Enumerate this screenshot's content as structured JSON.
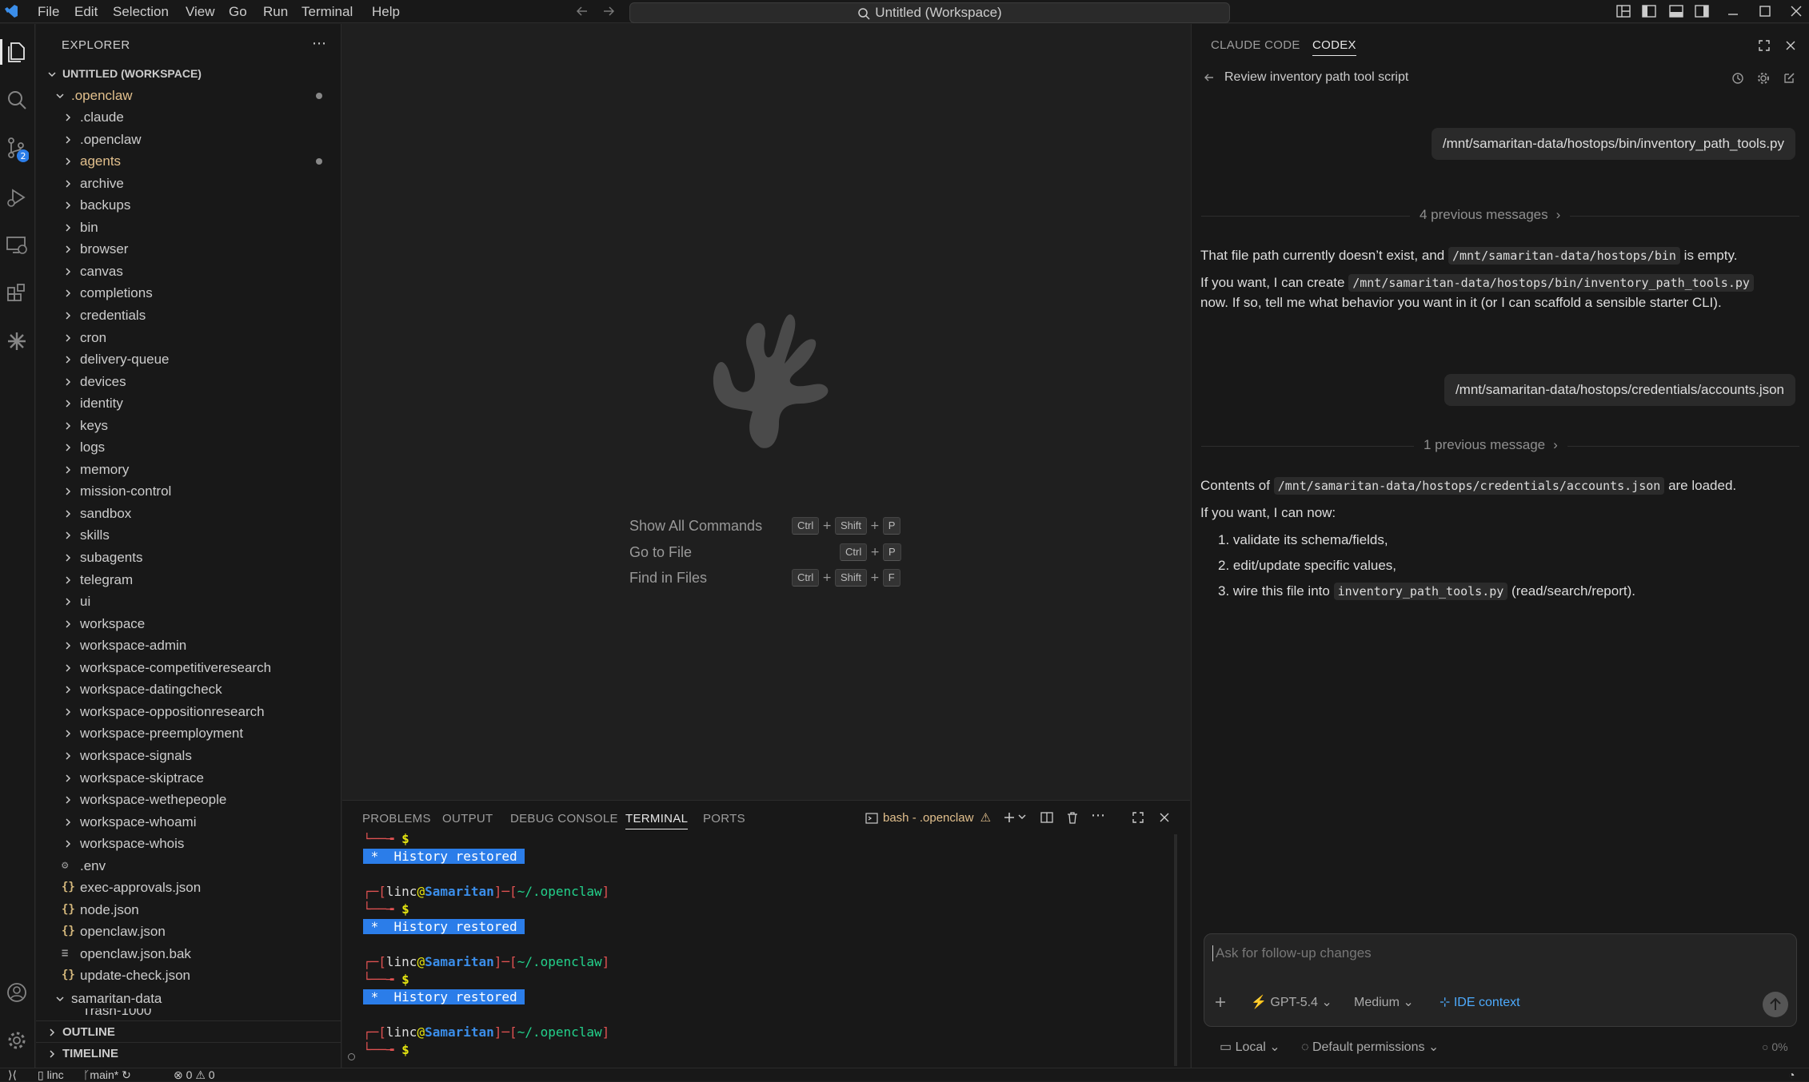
{
  "titlebar": {
    "menus": [
      "File",
      "Edit",
      "Selection",
      "View",
      "Go",
      "Run",
      "Terminal",
      "Help"
    ],
    "command_center": "Untitled (Workspace)"
  },
  "explorer": {
    "title": "EXPLORER",
    "workspace": "UNTITLED (WORKSPACE)",
    "root_folder": ".openclaw",
    "folders": [
      ".claude",
      ".openclaw",
      "agents",
      "archive",
      "backups",
      "bin",
      "browser",
      "canvas",
      "completions",
      "credentials",
      "cron",
      "delivery-queue",
      "devices",
      "identity",
      "keys",
      "logs",
      "memory",
      "mission-control",
      "sandbox",
      "skills",
      "subagents",
      "telegram",
      "ui",
      "workspace",
      "workspace-admin",
      "workspace-competitiveresearch",
      "workspace-datingcheck",
      "workspace-oppositionresearch",
      "workspace-preemployment",
      "workspace-signals",
      "workspace-skiptrace",
      "workspace-wethepeople",
      "workspace-whoami",
      "workspace-whois"
    ],
    "files": [
      ".env",
      "exec-approvals.json",
      "node.json",
      "openclaw.json",
      "openclaw.json.bak",
      "update-check.json"
    ],
    "second_folder": "samaritan-data",
    "partial_item": "Trash-1000",
    "outline": "OUTLINE",
    "timeline": "TIMELINE"
  },
  "editor": {
    "hints": [
      {
        "label": "Show All Commands",
        "keys": [
          "Ctrl",
          "Shift",
          "P"
        ]
      },
      {
        "label": "Go to File",
        "keys": [
          "Ctrl",
          "P"
        ]
      },
      {
        "label": "Find in Files",
        "keys": [
          "Ctrl",
          "Shift",
          "F"
        ]
      }
    ]
  },
  "panel": {
    "tabs": [
      "PROBLEMS",
      "OUTPUT",
      "DEBUG CONSOLE",
      "TERMINAL",
      "PORTS"
    ],
    "active_tab": "TERMINAL",
    "terminal_name": "bash - .openclaw",
    "prompt_user": "linc",
    "prompt_host": "Samaritan",
    "prompt_path": "~/.openclaw",
    "prompt_symbol": "$",
    "history_msg": " *  History restored "
  },
  "assistant": {
    "tabs": [
      "CLAUDE CODE",
      "CODEX"
    ],
    "active_tab": "CODEX",
    "thread_title": "Review inventory path tool script",
    "msg1": "/mnt/samaritan-data/hostops/bin/inventory_path_tools.py",
    "prev1": "4 previous messages",
    "r1a_pre": "That file path currently doesn’t exist, and",
    "r1a_code": "/mnt/samaritan-data/hostops/bin",
    "r1a_post": "is empty.",
    "r1b_pre": "If you want, I can create",
    "r1b_code": "/mnt/samaritan-data/hostops/bin/inventory_path_tools.py",
    "r1c": "now. If so, tell me what behavior you want in it (or I can scaffold a sensible starter CLI).",
    "msg2": "/mnt/samaritan-data/hostops/credentials/accounts.json",
    "prev2": "1 previous message",
    "r2a_pre": "Contents of",
    "r2a_code": "/mnt/samaritan-data/hostops/credentials/accounts.json",
    "r2a_post": "are loaded.",
    "r2b": "If you want, I can now:",
    "list1": "1. validate its schema/fields,",
    "list2": "2. edit/update specific values,",
    "list3_pre": "3. wire this file into",
    "list3_code": "inventory_path_tools.py",
    "list3_post": "(read/search/report).",
    "input_placeholder": "Ask for follow-up changes",
    "model": "GPT-5.4",
    "effort": "Medium",
    "context": "IDE context",
    "mode": "Local",
    "permissions": "Default permissions",
    "usage": "0%"
  },
  "statusbar": {
    "remote": "linc",
    "branch": "main*",
    "errors": "0",
    "warnings": "0"
  },
  "colors": {
    "accent": "#2b7de9",
    "folder_modified": "#e2c08d",
    "prompt_red": "#e05252",
    "prompt_host": "#3b8eea",
    "prompt_path": "#23d18b",
    "prompt_dollar": "#e5e510"
  }
}
